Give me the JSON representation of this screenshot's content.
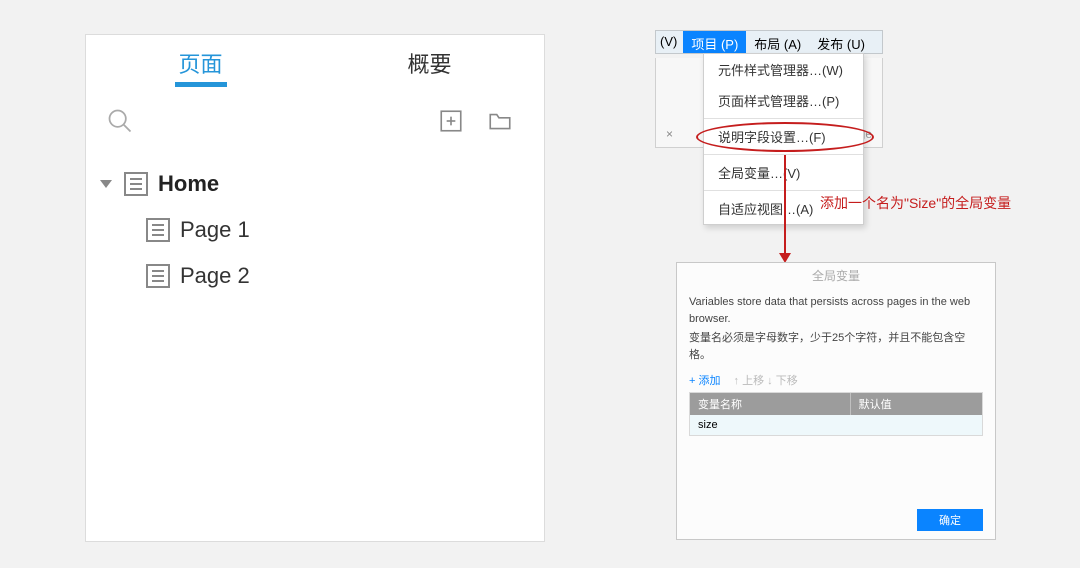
{
  "left_panel": {
    "tabs": {
      "pages": "页面",
      "overview": "概要"
    },
    "tree": {
      "root": "Home",
      "children": [
        "Page 1",
        "Page 2"
      ]
    }
  },
  "menubar": {
    "truncated": "(V)",
    "items": [
      "项目 (P)",
      "布局 (A)",
      "发布 (U)"
    ],
    "dropdown": [
      "元件样式管理器…(W)",
      "页面样式管理器…(P)",
      "说明字段设置…(F)",
      "全局变量…(V)",
      "自适应视图…(A)"
    ],
    "bg": {
      "close": "×",
      "page": "Page"
    }
  },
  "annotation": "添加一个名为\"Size\"的全局变量",
  "dialog": {
    "title": "全局变量",
    "desc1": "Variables store data that persists across pages in the web browser.",
    "desc2": "变量名必须是字母数字，少于25个字符，并且不能包含空格。",
    "tools": {
      "add": "+ 添加",
      "up": "↑ 上移",
      "down": "↓ 下移"
    },
    "columns": {
      "name": "变量名称",
      "default": "默认值"
    },
    "rows": [
      {
        "name": "size",
        "default": ""
      }
    ],
    "ok": "确定"
  }
}
